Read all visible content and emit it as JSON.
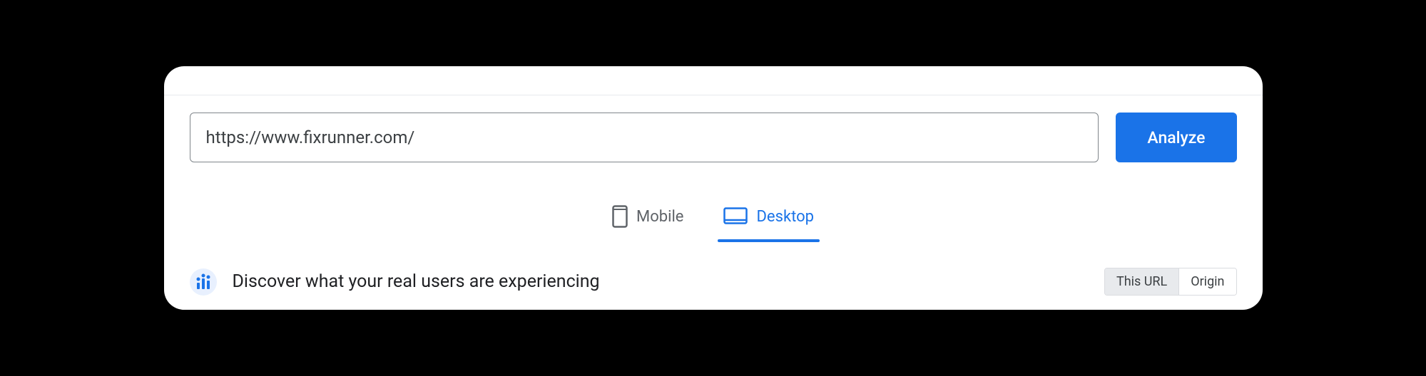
{
  "search": {
    "url_value": "https://www.fixrunner.com/",
    "analyze_label": "Analyze"
  },
  "tabs": {
    "mobile": {
      "label": "Mobile",
      "active": false
    },
    "desktop": {
      "label": "Desktop",
      "active": true
    }
  },
  "discover": {
    "title": "Discover what your real users are experiencing"
  },
  "toggle": {
    "this_url": "This URL",
    "origin": "Origin"
  }
}
